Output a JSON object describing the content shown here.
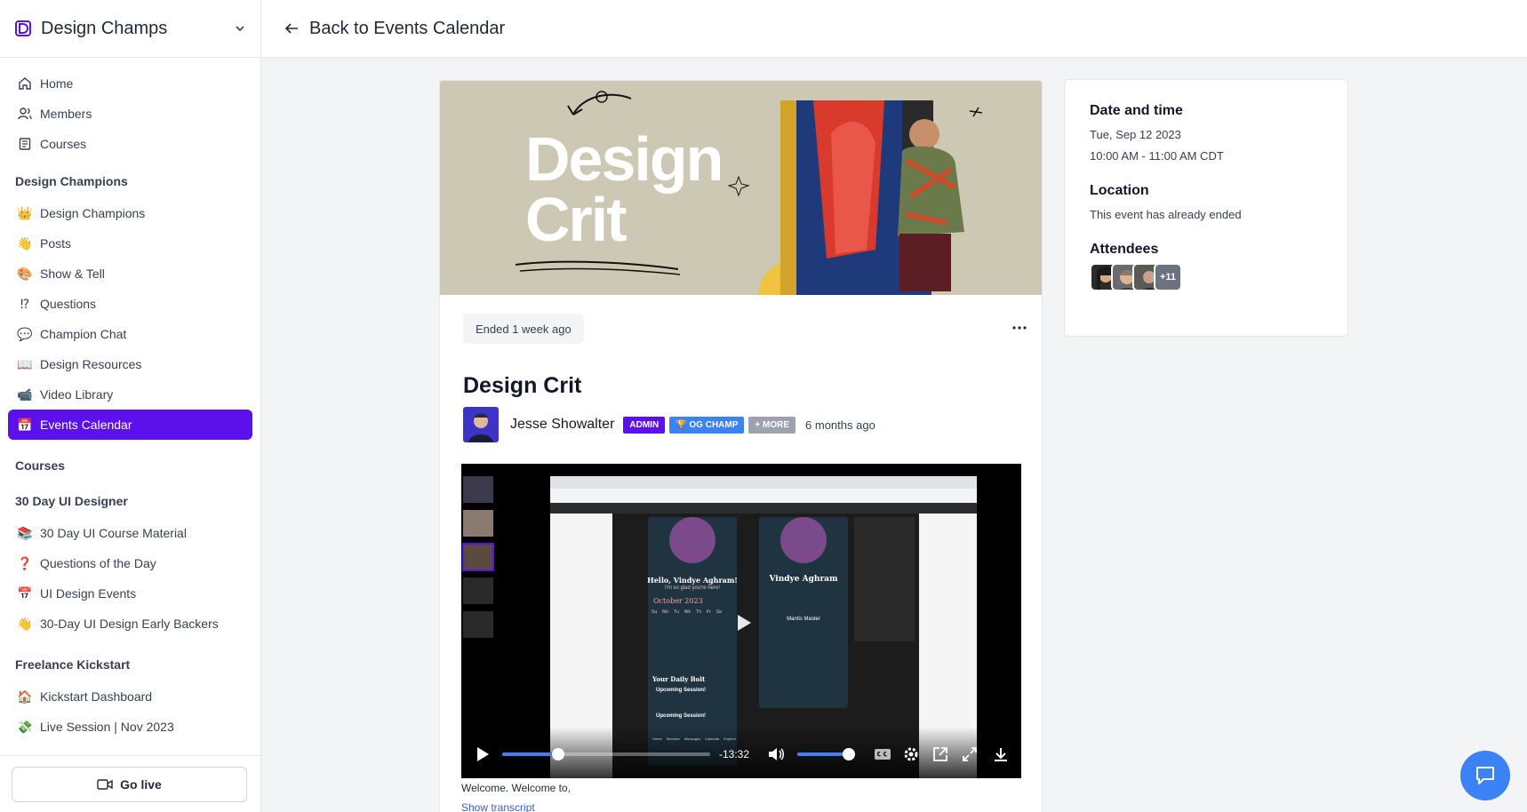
{
  "brand": {
    "name": "Design Champs"
  },
  "nav": {
    "main": [
      {
        "label": "Home",
        "icon": "home-icon"
      },
      {
        "label": "Members",
        "icon": "members-icon"
      },
      {
        "label": "Courses",
        "icon": "courses-icon"
      }
    ],
    "design_champions": {
      "title": "Design Champions",
      "items": [
        {
          "label": "Design Champions",
          "icon": "👑"
        },
        {
          "label": "Posts",
          "icon": "👋"
        },
        {
          "label": "Show & Tell",
          "icon": "🎨"
        },
        {
          "label": "Questions",
          "icon": "⁉"
        },
        {
          "label": "Champion Chat",
          "icon": "💬"
        },
        {
          "label": "Design Resources",
          "icon": "📖"
        },
        {
          "label": "Video Library",
          "icon": "📹"
        },
        {
          "label": "Events Calendar",
          "icon": "📅",
          "active": true
        }
      ]
    },
    "courses": {
      "title": "Courses"
    },
    "thirty_day": {
      "title": "30 Day UI Designer",
      "items": [
        {
          "label": "30 Day UI Course Material",
          "icon": "📚"
        },
        {
          "label": "Questions of the Day",
          "icon": "❓"
        },
        {
          "label": "UI Design Events",
          "icon": "📅"
        },
        {
          "label": "30-Day UI Design Early Backers",
          "icon": "👋"
        }
      ]
    },
    "freelance": {
      "title": "Freelance Kickstart",
      "items": [
        {
          "label": "Kickstart Dashboard",
          "icon": "🏠"
        },
        {
          "label": "Live Session | Nov 2023",
          "icon": "💸"
        }
      ]
    }
  },
  "footer": {
    "go_live": "Go live"
  },
  "topbar": {
    "back_label": "Back to Events Calendar"
  },
  "event": {
    "banner_title_1": "Design",
    "banner_title_2": "Crit",
    "status": "Ended 1 week ago",
    "title": "Design Crit",
    "host_name": "Jesse Showalter",
    "badges": {
      "admin": "ADMIN",
      "og": "🏆 OG CHAMP",
      "more": "+ MORE"
    },
    "posted": "6 months ago",
    "video": {
      "time_remaining": "-13:32",
      "progress": 0.27,
      "volume": 0.9,
      "screen_greeting": "Hello, Vindye Aghram!",
      "screen_subtitle": "I'm so glad you're here!",
      "screen_month": "October 2023",
      "screen_name": "Vindye Aghram",
      "screen_daily": "Your Daily Bolt",
      "screen_upcoming": "Upcoming Session!",
      "screen_upcoming_2": "Upcoming Session!",
      "screen_pill": "Mantis Master",
      "screen_tabs": [
        "Home",
        "Modules",
        "Messages",
        "Calendar",
        "Explore"
      ],
      "weekdays": [
        "Su",
        "Mo",
        "Tu",
        "We",
        "Th",
        "Fr",
        "Sa"
      ]
    },
    "caption": "Welcome. Welcome to,",
    "transcript_link": "Show transcript"
  },
  "details": {
    "date_heading": "Date and time",
    "date": "Tue, Sep 12 2023",
    "time": "10:00 AM - 11:00 AM CDT",
    "location_heading": "Location",
    "location": "This event has already ended",
    "attendees_heading": "Attendees",
    "attendees_more": "+11"
  },
  "colors": {
    "accent": "#5b10ec",
    "blue": "#3b82f6"
  }
}
